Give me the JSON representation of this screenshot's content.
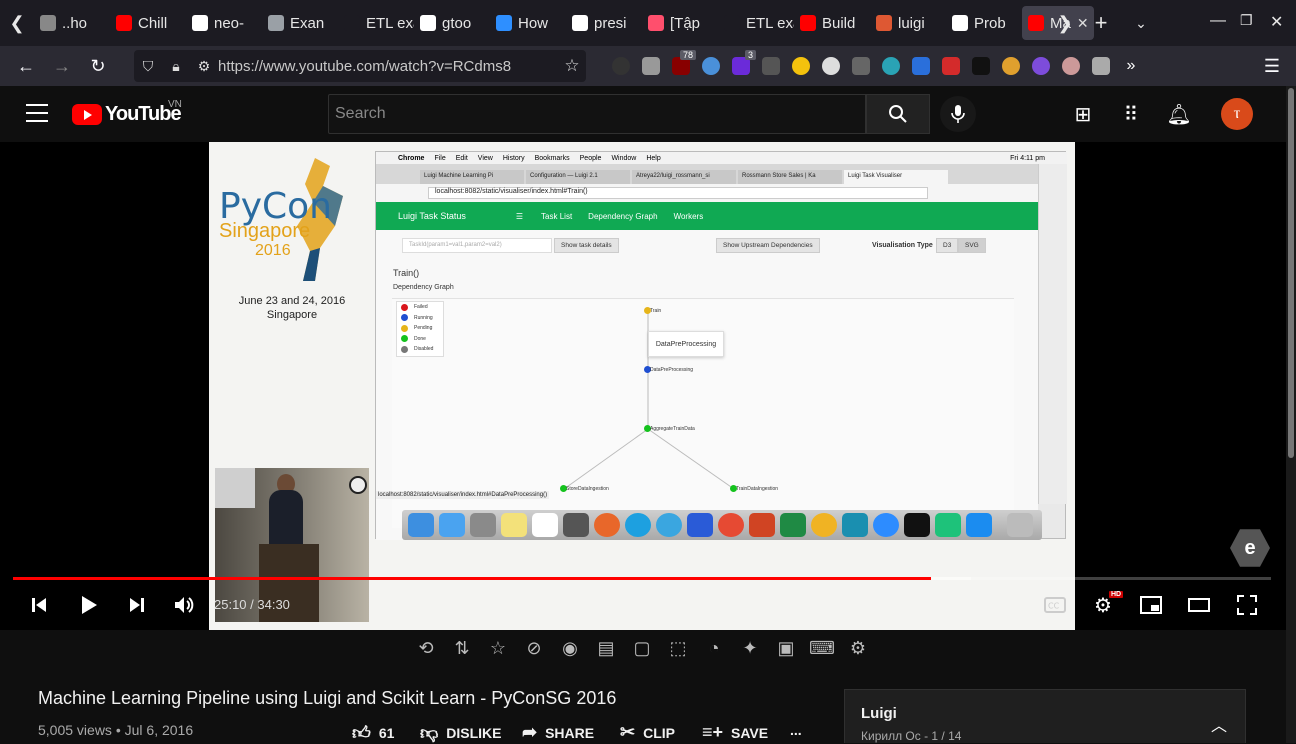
{
  "browser": {
    "tabs": [
      {
        "label": "..ho",
        "icon": "globe-icon",
        "color": "#888888"
      },
      {
        "label": "Chill",
        "icon": "youtube-icon",
        "color": "#ff0000"
      },
      {
        "label": "neo-",
        "icon": "github-icon",
        "color": "#ffffff"
      },
      {
        "label": "Exan",
        "icon": "table-icon",
        "color": "#9aa0a6"
      },
      {
        "label": "ETL exa",
        "icon": "blank-icon",
        "color": "#1c1b22"
      },
      {
        "label": "gtoo",
        "icon": "github-icon",
        "color": "#ffffff"
      },
      {
        "label": "How",
        "icon": "loop-icon",
        "color": "#2e8fff"
      },
      {
        "label": "presi",
        "icon": "github-icon",
        "color": "#ffffff"
      },
      {
        "label": "[Tập",
        "icon": "play-icon",
        "color": "#ff4f6d"
      },
      {
        "label": "ETL exa",
        "icon": "blank-icon",
        "color": "#1c1b22"
      },
      {
        "label": "Build",
        "icon": "youtube-icon",
        "color": "#ff0000"
      },
      {
        "label": "luigi",
        "icon": "duck-icon",
        "color": "#de5833"
      },
      {
        "label": "Prob",
        "icon": "info-icon",
        "color": "#ffffff"
      },
      {
        "label": "Ma",
        "icon": "youtube-icon",
        "color": "#ff0000",
        "active": true
      }
    ],
    "url": "https://www.youtube.com/watch?v=RCdms8",
    "extension_badges": {
      "b78": "78",
      "b3": "3"
    }
  },
  "youtube": {
    "country": "VN",
    "logo_text": "YouTube",
    "search_placeholder": "Search",
    "avatar_letter": "ⲧ"
  },
  "slide": {
    "pycon_title": "PyCon",
    "pycon_city": "Singapore",
    "pycon_year": "2016",
    "date_line1": "June 23 and 24, 2016",
    "date_line2": "Singapore"
  },
  "screen": {
    "mac_menu": [
      "Chrome",
      "File",
      "Edit",
      "View",
      "History",
      "Bookmarks",
      "People",
      "Window",
      "Help"
    ],
    "mac_clock": "Fri 4:11 pm",
    "chrome_tabs": [
      "Luigi Machine Learning Pi",
      "Configuration — Luigi 2.1",
      "Atreya22/luigi_rossmann_si",
      "Rossmann Store Sales | Ka",
      "Luigi Task Visualiser"
    ],
    "address": "localhost:8082/static/visualiser/index.html#Train()",
    "luigi_brand": "Luigi Task Status",
    "luigi_nav": [
      "Task List",
      "Dependency Graph",
      "Workers"
    ],
    "task_input_placeholder": "TaskId(param1=val1,param2=val2)",
    "show_details": "Show task details",
    "show_upstream": "Show Upstream Dependencies",
    "vis_type_label": "Visualisation Type",
    "vis_d3": "D3",
    "vis_svg": "SVG",
    "task_heading": "Train()",
    "graph_heading": "Dependency Graph",
    "legend": [
      {
        "label": "Failed",
        "color": "#d9161c"
      },
      {
        "label": "Running",
        "color": "#1f4fd1"
      },
      {
        "label": "Pending",
        "color": "#e6b51a"
      },
      {
        "label": "Done",
        "color": "#14c21d"
      },
      {
        "label": "Disabled",
        "color": "#777777"
      }
    ],
    "nodes": {
      "train": "Train",
      "data_pre": "DataPreProcessing",
      "aggregate": "AggregateTrainData",
      "store": "StoreDataIngestion",
      "train_ing": "TrainDataIngestion"
    },
    "tooltip": "DataPreProcessing",
    "status_url": "localhost:8082/static/visualiser/index.html#DataPreProcessing()"
  },
  "player": {
    "time": "25:10 / 34:30",
    "progress_fraction": 0.73,
    "hd": "HD"
  },
  "video": {
    "title": "Machine Learning Pipeline using Luigi and Scikit Learn - PyConSG 2016",
    "views": "5,005 views",
    "date": "Jul 6, 2016",
    "likes": "61",
    "dislike": "DISLIKE",
    "share": "SHARE",
    "clip": "CLIP",
    "save": "SAVE",
    "more": "..."
  },
  "playlist": {
    "title": "Luigi",
    "subtitle": "Кирилл Ос - 1 / 14"
  }
}
